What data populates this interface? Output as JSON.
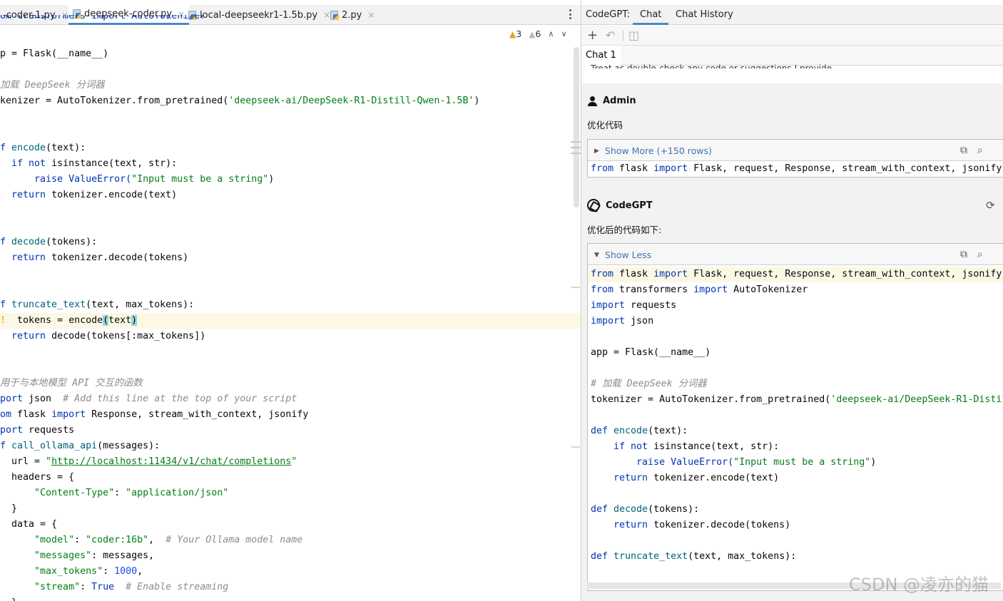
{
  "editor": {
    "tabs": [
      {
        "label": "-coder-1.py",
        "close": "×"
      },
      {
        "label": "deepseek-coder.py",
        "close": "×"
      },
      {
        "label": "local-deepseekr1-1.5b.py",
        "close": "×"
      },
      {
        "label": "2.py",
        "close": "×"
      }
    ],
    "inspections": {
      "warnings": "3",
      "weak_warnings": "6",
      "warn_glyph": "▲",
      "weak_glyph": "▲",
      "up": "∧",
      "down": "∨"
    },
    "cut_top_line": "om transformers import AutoTokenizer",
    "lines": {
      "l1_a": "p = Flask(__name__)",
      "l2_cmt": "加载 DeepSeek 分词器",
      "l3_a": "kenizer = AutoTokenizer.from_pretrained(",
      "l3_str": "'deepseek-ai/DeepSeek-R1-Distill-Qwen-1.5B'",
      "l3_b": ")",
      "l4_kw": "f ",
      "l4_fn": "encode",
      "l4_b": "(text):",
      "l5_kw1": "  if not ",
      "l5_a": "isinstance(text, str):",
      "l6_kw": "      raise ",
      "l6_a": "ValueError(",
      "l6_str": "\"Input must be a string\"",
      "l6_b": ")",
      "l7_kw": "  return ",
      "l7_a": "tokenizer.encode(text)",
      "l8_kw": "f ",
      "l8_fn": "decode",
      "l8_b": "(tokens):",
      "l9_kw": "  return ",
      "l9_a": "tokenizer.decode(tokens)",
      "l10_kw": "f ",
      "l10_fn": "truncate_text",
      "l10_b": "(text, max_tokens):",
      "l11_bulb": "!",
      "l11_a": "  tokens = encode",
      "l11_br1": "(",
      "l11_b": "text",
      "l11_br2": ")",
      "l12_kw": "  return ",
      "l12_a": "decode(tokens[:max_tokens])",
      "l13_cmt": "用于与本地模型 API 交互的函数",
      "l14_kw": "port ",
      "l14_a": "json  ",
      "l14_cmt": "# Add this line at the top of your script",
      "l15_kw1": "om ",
      "l15_a": "flask ",
      "l15_kw2": "import ",
      "l15_b": "Response, stream_with_context, jsonify",
      "l16_kw": "port ",
      "l16_a": "requests",
      "l17_kw": "f ",
      "l17_fn": "call_ollama_api",
      "l17_b": "(messages):",
      "l18_a": "  url = ",
      "l18_q1": "\"",
      "l18_url": "http://localhost:11434/v1/chat/completions",
      "l18_q2": "\"",
      "l19_a": "  headers = {",
      "l20_s1": "      \"Content-Type\"",
      "l20_a": ": ",
      "l20_s2": "\"application/json\"",
      "l21_a": "  }",
      "l22_a": "  data = {",
      "l23_s1": "      \"model\"",
      "l23_a": ": ",
      "l23_s2": "\"coder:16b\"",
      "l23_b": ",  ",
      "l23_cmt": "# Your Ollama model name",
      "l24_s1": "      \"messages\"",
      "l24_a": ": messages,",
      "l25_s1": "      \"max_tokens\"",
      "l25_a": ": ",
      "l25_num": "1000",
      "l25_b": ",",
      "l26_s1": "      \"stream\"",
      "l26_a": ": ",
      "l26_kw": "True",
      "l26_b": "  ",
      "l26_cmt": "# Enable streaming",
      "l27_a": "  }"
    }
  },
  "panel": {
    "tabs": {
      "title": "CodeGPT:",
      "chat": "Chat",
      "history": "Chat History"
    },
    "toolbar": {
      "add": "+",
      "undo": "↶",
      "layout": "◫"
    },
    "chat_tab": "Chat 1",
    "cut_text": "Treat as double-check any code or suggestions I provide.",
    "user_msg": {
      "author": "Admin",
      "text": "优化代码",
      "showmore": "Show More (+150 rows)",
      "tri": "▶",
      "copy": "⧉",
      "search": "⌕",
      "code": {
        "kw1": "from ",
        "a": "flask ",
        "kw2": "import ",
        "b": "Flask, request, Response, stream_with_context, jsonify"
      }
    },
    "bot_msg": {
      "author": "CodeGPT",
      "regen": "⟳",
      "text": "优化后的代码如下:",
      "showless": "Show Less",
      "tri": "▼",
      "copy": "⧉",
      "search": "⌕",
      "lines": {
        "c1_kw1": "from ",
        "c1_a": "flask ",
        "c1_kw2": "import ",
        "c1_b": "Flask, request, Response, stream_with_context, jsonify",
        "c2_kw1": "from ",
        "c2_a": "transformers ",
        "c2_kw2": "import ",
        "c2_b": "AutoTokenizer",
        "c3_kw": "import ",
        "c3_a": "requests",
        "c4_kw": "import ",
        "c4_a": "json",
        "c5_a": "app = Flask(__name__)",
        "c6_cmt": "# 加载 DeepSeek 分词器",
        "c7_a": "tokenizer = AutoTokenizer.from_pretrained(",
        "c7_str": "'deepseek-ai/DeepSeek-R1-Distil",
        "c8_kw": "def ",
        "c8_fn": "encode",
        "c8_b": "(text):",
        "c9_kw": "    if not ",
        "c9_a": "isinstance(text, str):",
        "c10_kw": "        raise ",
        "c10_a": "ValueError(",
        "c10_str": "\"Input must be a string\"",
        "c10_b": ")",
        "c11_kw": "    return ",
        "c11_a": "tokenizer.encode(text)",
        "c12_kw": "def ",
        "c12_fn": "decode",
        "c12_b": "(tokens):",
        "c13_kw": "    return ",
        "c13_a": "tokenizer.decode(tokens)",
        "c14_kw": "def ",
        "c14_fn": "truncate_text",
        "c14_b": "(text, max_tokens):"
      }
    }
  },
  "watermark": "CSDN @凌亦的猫"
}
